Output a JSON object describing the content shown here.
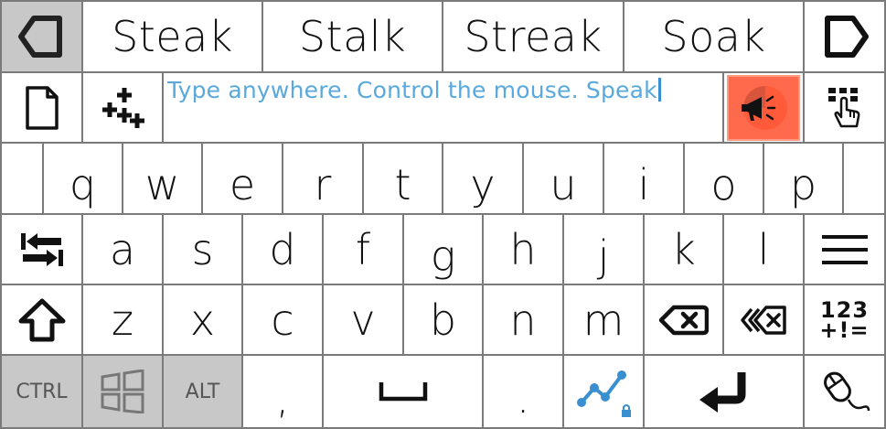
{
  "suggestions": [
    "Steak",
    "Stalk",
    "Streak",
    "Soak"
  ],
  "input": {
    "placeholder": "Type anywhere. Control the mouse. Speak"
  },
  "rows": {
    "row1": [
      "q",
      "w",
      "e",
      "r",
      "t",
      "y",
      "u",
      "i",
      "o",
      "p"
    ],
    "row2": [
      "a",
      "s",
      "d",
      "f",
      "g",
      "h",
      "j",
      "k",
      "l"
    ],
    "row3": [
      "z",
      "x",
      "c",
      "v",
      "b",
      "n",
      "m"
    ]
  },
  "modifiers": {
    "ctrl": "CTRL",
    "alt": "ALT",
    "comma": ",",
    "period": "."
  },
  "numbers_key": {
    "top": "123",
    "bottom": "+!="
  },
  "icons": {
    "back": "back-arrow-icon",
    "forward": "forward-arrow-icon",
    "document": "document-icon",
    "add": "add-sparkle-icon",
    "speak": "megaphone-icon",
    "keypad": "keypad-touch-icon",
    "tab": "tab-arrows-icon",
    "menu": "hamburger-menu-icon",
    "shift": "shift-arrow-icon",
    "backspace": "backspace-icon",
    "delete_word": "delete-word-icon",
    "windows": "windows-logo-icon",
    "space": "space-bar-icon",
    "swipe": "swipe-path-icon",
    "enter": "enter-arrow-icon",
    "mouse": "mouse-icon"
  },
  "colors": {
    "accent": "#5aa9dd",
    "speak": "#ff6a4d",
    "swipe": "#3a8fd1",
    "gray_key": "#c8c8c8"
  }
}
